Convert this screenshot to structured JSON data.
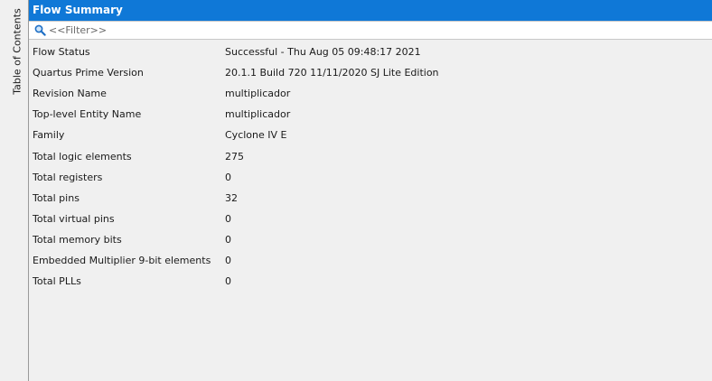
{
  "toc": {
    "label": "Table of Contents"
  },
  "panel": {
    "title": "Flow Summary",
    "filter_placeholder": "<<Filter>>"
  },
  "rows": [
    {
      "key": "Flow Status",
      "value": "Successful - Thu Aug 05 09:48:17 2021"
    },
    {
      "key": "Quartus Prime Version",
      "value": "20.1.1 Build 720 11/11/2020 SJ Lite Edition"
    },
    {
      "key": "Revision Name",
      "value": "multiplicador"
    },
    {
      "key": "Top-level Entity Name",
      "value": "multiplicador"
    },
    {
      "key": "Family",
      "value": "Cyclone IV E"
    },
    {
      "key": "Total logic elements",
      "value": "275"
    },
    {
      "key": "Total registers",
      "value": "0"
    },
    {
      "key": "Total pins",
      "value": "32"
    },
    {
      "key": "Total virtual pins",
      "value": "0"
    },
    {
      "key": "Total memory bits",
      "value": "0"
    },
    {
      "key": "Embedded Multiplier 9-bit elements",
      "value": "0"
    },
    {
      "key": "Total PLLs",
      "value": "0"
    }
  ],
  "colors": {
    "title_bar": "#0f78d7",
    "background": "#f0f0f0"
  },
  "icons": {
    "filter": "search-icon"
  }
}
